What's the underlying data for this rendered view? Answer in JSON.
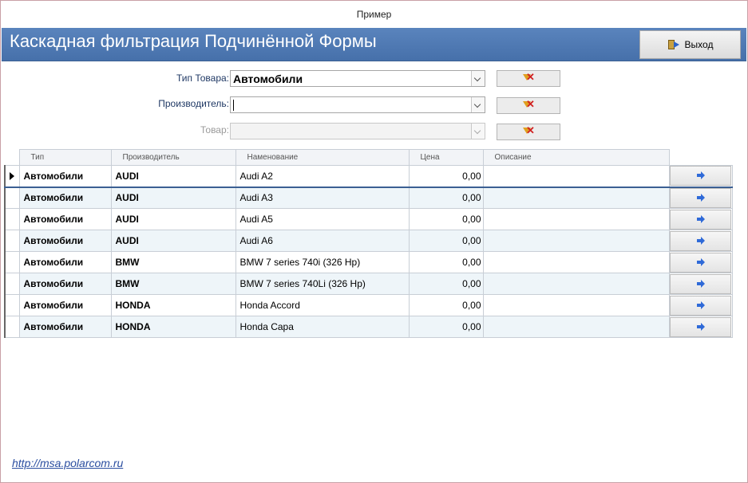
{
  "window": {
    "title": "Пример"
  },
  "header": {
    "title": "Каскадная фильтрация Подчинённой Формы",
    "color": "#4f7ab6"
  },
  "exit_button": {
    "label": "Выход"
  },
  "filters": [
    {
      "label": "Тип Товара:",
      "value": "Автомобили",
      "enabled": true
    },
    {
      "label": "Производитель:",
      "value": "",
      "enabled": true
    },
    {
      "label": "Товар:",
      "value": "",
      "enabled": false
    }
  ],
  "grid": {
    "columns": [
      "Тип",
      "Производитель",
      "Наменование",
      "Цена",
      "Описание"
    ],
    "rows": [
      {
        "type": "Автомобили",
        "maker": "AUDI",
        "name": "Audi A2",
        "price": "0,00",
        "desc": ""
      },
      {
        "type": "Автомобили",
        "maker": "AUDI",
        "name": "Audi A3",
        "price": "0,00",
        "desc": ""
      },
      {
        "type": "Автомобили",
        "maker": "AUDI",
        "name": "Audi A5",
        "price": "0,00",
        "desc": ""
      },
      {
        "type": "Автомобили",
        "maker": "AUDI",
        "name": "Audi A6",
        "price": "0,00",
        "desc": ""
      },
      {
        "type": "Автомобили",
        "maker": "BMW",
        "name": "BMW 7 series 740i (326 Hp)",
        "price": "0,00",
        "desc": ""
      },
      {
        "type": "Автомобили",
        "maker": "BMW",
        "name": "BMW 7 series 740Li (326 Hp)",
        "price": "0,00",
        "desc": ""
      },
      {
        "type": "Автомобили",
        "maker": "HONDA",
        "name": "Honda Accord",
        "price": "0,00",
        "desc": ""
      },
      {
        "type": "Автомобили",
        "maker": "HONDA",
        "name": "Honda Capa",
        "price": "0,00",
        "desc": ""
      }
    ]
  },
  "footer": {
    "link": "http://msa.polarcom.ru"
  },
  "icons": {
    "exit": "exit-door-icon",
    "clear": "clear-filter-icon",
    "open": "arrow-right-icon"
  }
}
